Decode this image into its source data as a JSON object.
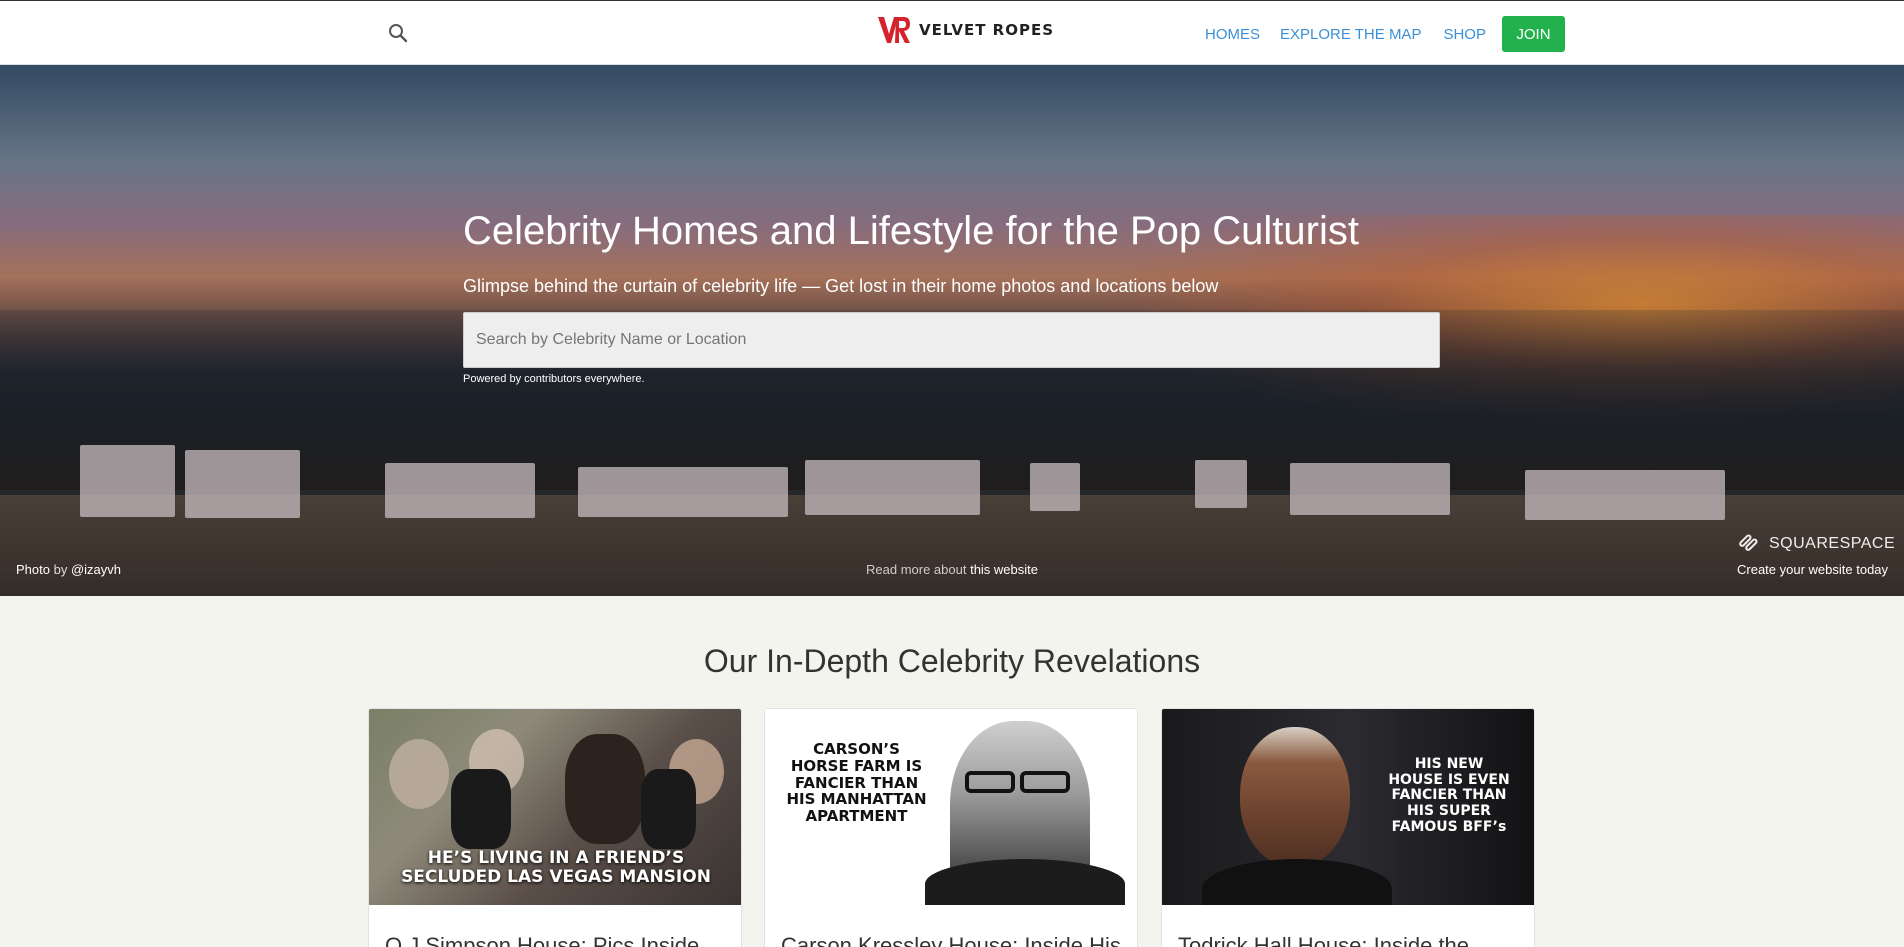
{
  "header": {
    "brand": "VELVET ROPES",
    "nav": {
      "homes": "HOMES",
      "explore": "EXPLORE THE MAP",
      "shop": "SHOP",
      "join": "JOIN"
    }
  },
  "hero": {
    "title": "Celebrity Homes and Lifestyle for the Pop Culturist",
    "subtitle": "Glimpse behind the curtain of celebrity life — Get lost in their home photos and locations below",
    "search_placeholder": "Search by Celebrity Name or Location",
    "powered": "Powered by contributors everywhere.",
    "photo_credit_prefix": "Photo",
    "photo_credit_by": " by ",
    "photo_credit_handle": "@izayvh",
    "read_more_prefix": "Read more about ",
    "read_more_link": "this website",
    "squarespace_brand": "SQUARESPACE",
    "squarespace_tagline": "Create your website today"
  },
  "section": {
    "title": "Our In-Depth Celebrity Revelations"
  },
  "cards": [
    {
      "caption_line1": "HE’S LIVING IN A FRIEND’S",
      "caption_line2": "SECLUDED LAS VEGAS MANSION",
      "title": "O.J Simpson House: Pics Inside"
    },
    {
      "caption_line1": "CARSON’S",
      "caption_line2": "HORSE FARM IS",
      "caption_line3": "FANCIER THAN",
      "caption_line4": "HIS MANHATTAN",
      "caption_line5": "APARTMENT",
      "title": "Carson Kressley House: Inside His"
    },
    {
      "caption_line1": "HIS NEW",
      "caption_line2": "HOUSE IS EVEN",
      "caption_line3": "FANCIER THAN",
      "caption_line4": "HIS SUPER",
      "caption_line5": "FAMOUS BFF’s",
      "title": "Todrick Hall House: Inside the"
    }
  ],
  "colors": {
    "accent_blue": "#3b8fd6",
    "join_green": "#22b14c",
    "brand_red": "#d4232d"
  },
  "icons": {
    "search": "search-icon",
    "logo": "vr-logo-icon",
    "squarespace": "squarespace-logo-icon"
  }
}
